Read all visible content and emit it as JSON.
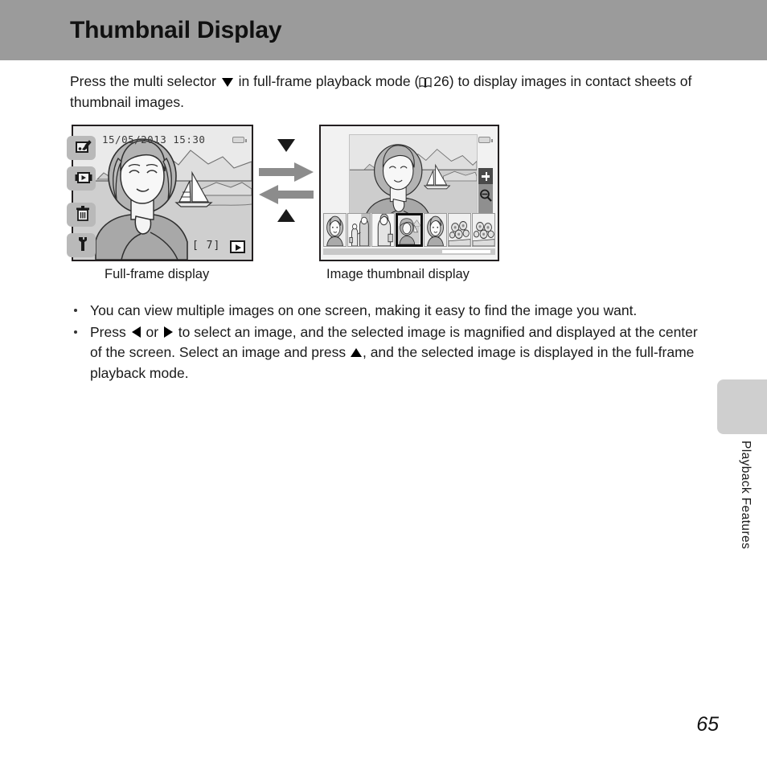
{
  "header": {
    "title": "Thumbnail Display",
    "band_color": "#9b9b9b"
  },
  "intro": {
    "part1": "Press the multi selector",
    "icon_down": "triangle-down-icon",
    "part2": "in full-frame playback mode (",
    "book_icon": "book-icon",
    "page_ref": "26)",
    "part3": "to display images in contact sheets of thumbnail images."
  },
  "figure": {
    "left_screen": {
      "caption": "Full-frame display",
      "datetime": "15/05/2013 15:30",
      "counter": "[      7]",
      "battery_icon": "battery-icon",
      "playback_icon": "playback-mode-icon",
      "side_icons": [
        {
          "name": "retouch-icon",
          "label": "Retouch"
        },
        {
          "name": "movie-playback-icon",
          "label": "Movie playback"
        },
        {
          "name": "delete-icon",
          "label": "Delete"
        },
        {
          "name": "setup-wrench-icon",
          "label": "Setup"
        }
      ],
      "scene": "woman-portrait-with-sailboat-and-mountains"
    },
    "right_screen": {
      "caption": "Image thumbnail display",
      "battery_icon": "battery-icon",
      "zoom_in_icon": "zoom-in-plus-icon",
      "zoom_out_icon": "zoom-out-magnifier-icon",
      "thumbnail_count": 7,
      "selected_index": 3,
      "thumbnails": [
        "portrait-child",
        "two-people-standing",
        "person-with-bag",
        "woman-portrait-selected",
        "portrait-child-2",
        "flowers",
        "flowers-2"
      ]
    },
    "arrows": {
      "down_triangle": "triangle-down-icon",
      "right_arrow": "arrow-right-icon",
      "left_arrow": "arrow-left-icon",
      "up_triangle": "triangle-up-icon",
      "arrow_color": "#8c8c8c",
      "triangle_color": "#1a1a1a"
    }
  },
  "bullets": [
    {
      "segments": [
        {
          "type": "text",
          "value": "You can view multiple images on one screen, making it easy to find the image you want."
        }
      ]
    },
    {
      "segments": [
        {
          "type": "text",
          "value": "Press "
        },
        {
          "type": "icon",
          "value": "triangle-left-icon"
        },
        {
          "type": "text",
          "value": " or "
        },
        {
          "type": "icon",
          "value": "triangle-right-icon"
        },
        {
          "type": "text",
          "value": " to select an image, and the selected image is magnified and displayed at the center of the screen. Select an image and press "
        },
        {
          "type": "icon",
          "value": "triangle-up-icon"
        },
        {
          "type": "text",
          "value": ", and the selected image is displayed in the full-frame playback mode."
        }
      ]
    }
  ],
  "bullet_text": {
    "b1": "You can view multiple images on one screen, making it easy to find the image you want.",
    "b2_a": "Press ",
    "b2_b": " or ",
    "b2_c": " to select an image, and the selected image is magnified and displayed at the center of the screen. Select an image and press ",
    "b2_d": ", and the selected image is displayed in the full-frame playback mode."
  },
  "side_tab": {
    "label": "Playback Features",
    "tab_color": "#cfcfcf"
  },
  "footer": {
    "page_number": "65"
  }
}
